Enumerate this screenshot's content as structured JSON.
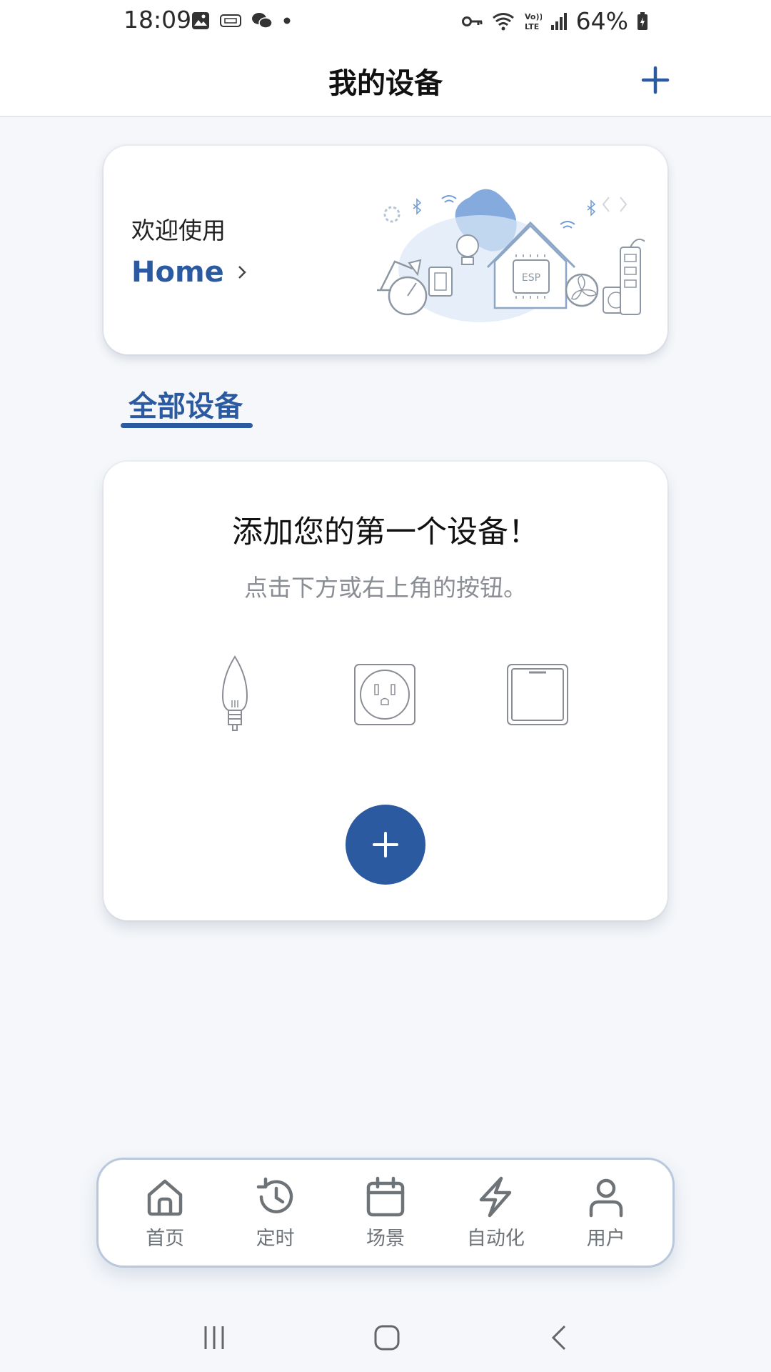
{
  "status_bar": {
    "time": "18:09",
    "battery_percent": "64%",
    "left_icons": [
      "image-notification-icon",
      "tape-icon",
      "wechat-icon",
      "dot-icon"
    ],
    "right_icons": [
      "vpn-key-icon",
      "wifi-icon",
      "volte-icon",
      "signal-icon",
      "battery-icon"
    ]
  },
  "header": {
    "title": "我的设备",
    "add_icon": "plus-icon"
  },
  "welcome_card": {
    "label": "欢迎使用",
    "home_name": "Home"
  },
  "tabs": [
    {
      "label": "全部设备",
      "active": true
    }
  ],
  "empty_state": {
    "title": "添加您的第一个设备！",
    "subtitle": "点击下方或右上角的按钮。",
    "device_icons": [
      "bulb-icon",
      "socket-icon",
      "switch-icon"
    ],
    "add_icon": "plus-icon"
  },
  "bottom_nav": {
    "items": [
      {
        "label": "首页",
        "icon": "home-icon"
      },
      {
        "label": "定时",
        "icon": "history-icon"
      },
      {
        "label": "场景",
        "icon": "calendar-icon"
      },
      {
        "label": "自动化",
        "icon": "lightning-icon"
      },
      {
        "label": "用户",
        "icon": "user-icon"
      }
    ]
  },
  "colors": {
    "accent": "#2b5aa0",
    "background": "#f5f7fa",
    "card": "#ffffff",
    "nav_icon": "#6e7378"
  }
}
